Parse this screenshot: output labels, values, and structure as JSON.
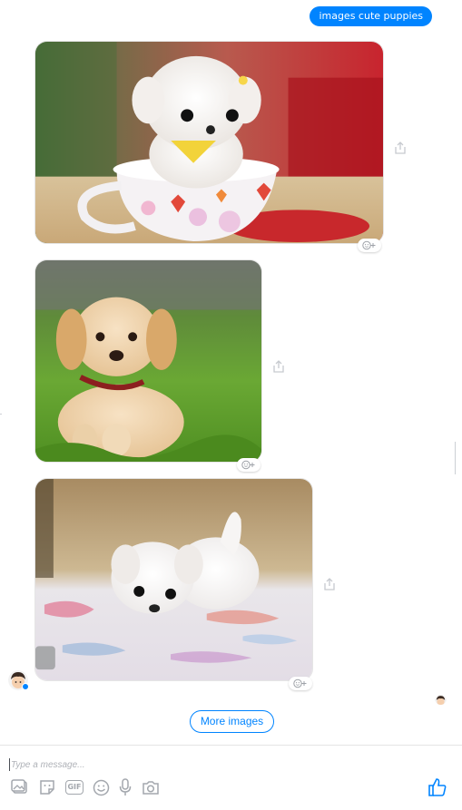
{
  "conversation": {
    "sent_message": "images cute puppies",
    "images": [
      {
        "subject": "white fluffy puppy in a teacup"
      },
      {
        "subject": "golden retriever puppy on grass"
      },
      {
        "subject": "white puppy lying on a blanket"
      }
    ],
    "more_images_label": "More images"
  },
  "composer": {
    "placeholder": "Type a message...",
    "toolbar_icons": [
      "photo-icon",
      "sticker-icon",
      "gif-icon",
      "emoji-icon",
      "microphone-icon",
      "camera-icon"
    ],
    "gif_label": "GIF",
    "like_icon": "thumbs-up-icon"
  },
  "colors": {
    "accent": "#0084ff",
    "icon_gray": "#a3a7ad"
  }
}
